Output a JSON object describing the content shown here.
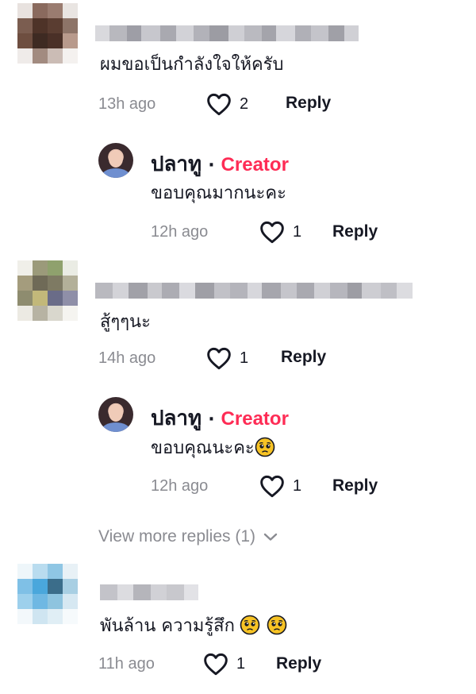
{
  "comments": [
    {
      "text": "ผมขอเป็นกำลังใจให้ครับ",
      "time": "13h ago",
      "likes": "2",
      "reply_label": "Reply",
      "reply": {
        "author": "ปลาทู",
        "badge": "Creator",
        "text": "ขอบคุณมากนะคะ",
        "time": "12h ago",
        "likes": "1",
        "reply_label": "Reply"
      }
    },
    {
      "text": "สู้ๆๆนะ",
      "time": "14h ago",
      "likes": "1",
      "reply_label": "Reply",
      "reply": {
        "author": "ปลาทู",
        "badge": "Creator",
        "text": "ขอบคุณนะคะ",
        "emoji": "pleading-face-icon",
        "time": "12h ago",
        "likes": "1",
        "reply_label": "Reply"
      },
      "view_more": "View more replies (1)"
    },
    {
      "text": "พันล้าน ความรู้สึก",
      "emoji_count": 2,
      "emoji": "pleading-face-icon",
      "time": "11h ago",
      "likes": "1",
      "reply_label": "Reply"
    }
  ],
  "colors": {
    "creator_badge": "#fe2c55",
    "meta_text": "#8a8b91",
    "primary_text": "#161823"
  },
  "icons": {
    "like": "heart-outline-icon",
    "expand": "chevron-down-icon"
  }
}
